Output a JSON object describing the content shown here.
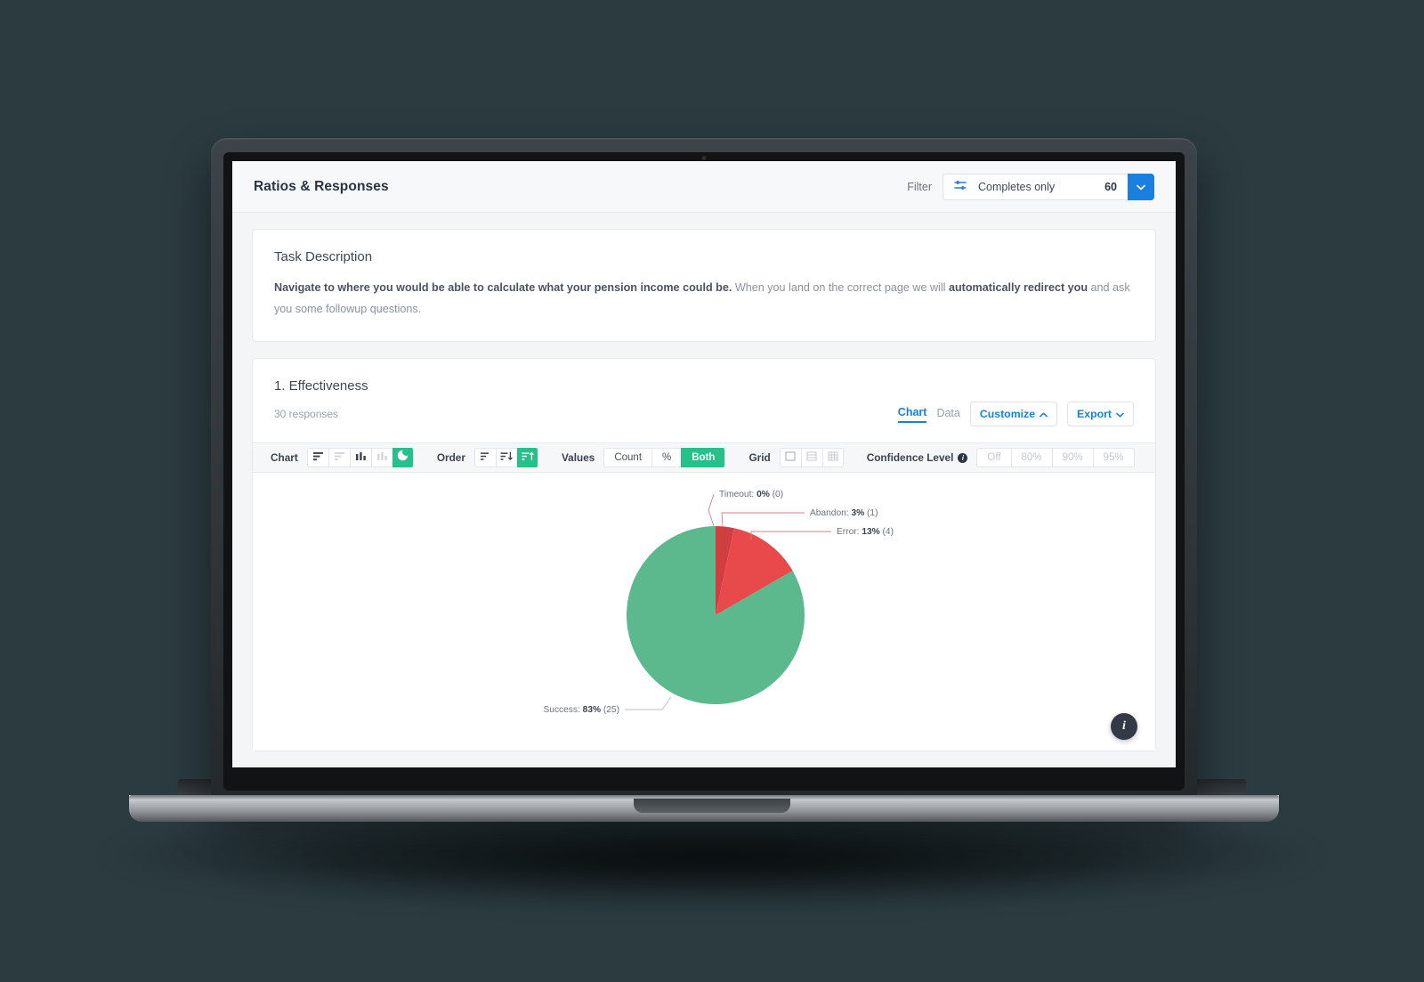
{
  "topbar": {
    "title": "Ratios & Responses",
    "filter_label": "Filter",
    "filter_icon": "sliders-icon",
    "filter_value": "Completes only",
    "filter_count": "60",
    "dropdown_icon": "chevron-down-icon"
  },
  "task_card": {
    "heading": "Task Description",
    "text_bold_1": "Navigate to where you would be able to calculate what your pension income could be.",
    "text_plain_1": " When you land on the correct page we will ",
    "text_bold_2": "automatically redirect you",
    "text_plain_2": " and ask you some followup questions."
  },
  "section": {
    "title": "1. Effectiveness",
    "responses": "30 responses",
    "tabs": [
      {
        "label": "Chart",
        "active": true
      },
      {
        "label": "Data",
        "active": false
      }
    ],
    "customize_label": "Customize",
    "customize_icon": "chevron-up-icon",
    "export_label": "Export",
    "export_icon": "chevron-down-icon"
  },
  "toolbar": {
    "chart_label": "Chart",
    "chart_options": [
      {
        "icon": "bar-horizontal-icon",
        "state": "enabled"
      },
      {
        "icon": "bar-horizontal-stacked-icon",
        "state": "disabled"
      },
      {
        "icon": "bar-vertical-icon",
        "state": "enabled"
      },
      {
        "icon": "bar-vertical-stacked-icon",
        "state": "disabled"
      },
      {
        "icon": "pie-chart-icon",
        "state": "active"
      }
    ],
    "order_label": "Order",
    "order_options": [
      {
        "icon": "sort-default-icon",
        "state": "enabled"
      },
      {
        "icon": "sort-descending-icon",
        "state": "enabled"
      },
      {
        "icon": "sort-ascending-icon",
        "state": "active"
      }
    ],
    "values_label": "Values",
    "values_options": [
      {
        "label": "Count",
        "active": false
      },
      {
        "label": "%",
        "active": false
      },
      {
        "label": "Both",
        "active": true
      }
    ],
    "grid_label": "Grid",
    "grid_options": [
      {
        "icon": "grid-none-icon",
        "state": "enabled"
      },
      {
        "icon": "grid-rows-icon",
        "state": "disabled"
      },
      {
        "icon": "grid-full-icon",
        "state": "disabled"
      }
    ],
    "confidence_label": "Confidence Level",
    "confidence_info_icon": "info-icon",
    "confidence_options": [
      {
        "label": "Off",
        "active": false,
        "dim": true
      },
      {
        "label": "80%",
        "active": false,
        "dim": true
      },
      {
        "label": "90%",
        "active": false,
        "dim": true
      },
      {
        "label": "95%",
        "active": false,
        "dim": true
      }
    ]
  },
  "fab": {
    "icon": "info-icon",
    "label": "i"
  },
  "colors": {
    "success": "#5cb98e",
    "error": "#e8494a",
    "abandon": "#cf3f41",
    "timeout": "#e8494a",
    "accent_blue": "#1a7fdd",
    "accent_green": "#27c08a",
    "leader_line": "#e07c7c"
  },
  "chart_data": {
    "type": "pie",
    "title": "1. Effectiveness",
    "total_responses": 30,
    "categories": [
      "Success",
      "Error",
      "Abandon",
      "Timeout"
    ],
    "values": [
      25,
      4,
      1,
      0
    ],
    "percents": [
      83,
      13,
      3,
      0
    ],
    "colors": [
      "#5cb98e",
      "#e8494a",
      "#cf3f41",
      "#e8494a"
    ],
    "labels": [
      {
        "name": "Timeout",
        "pct": "0%",
        "count": "(0)",
        "text": "Timeout: 0% (0)"
      },
      {
        "name": "Abandon",
        "pct": "3%",
        "count": "(1)",
        "text": "Abandon: 3% (1)"
      },
      {
        "name": "Error",
        "pct": "13%",
        "count": "(4)",
        "text": "Error: 13% (4)"
      },
      {
        "name": "Success",
        "pct": "83%",
        "count": "(25)",
        "text": "Success: 83% (25)"
      }
    ],
    "legend": "none",
    "grid": false
  }
}
